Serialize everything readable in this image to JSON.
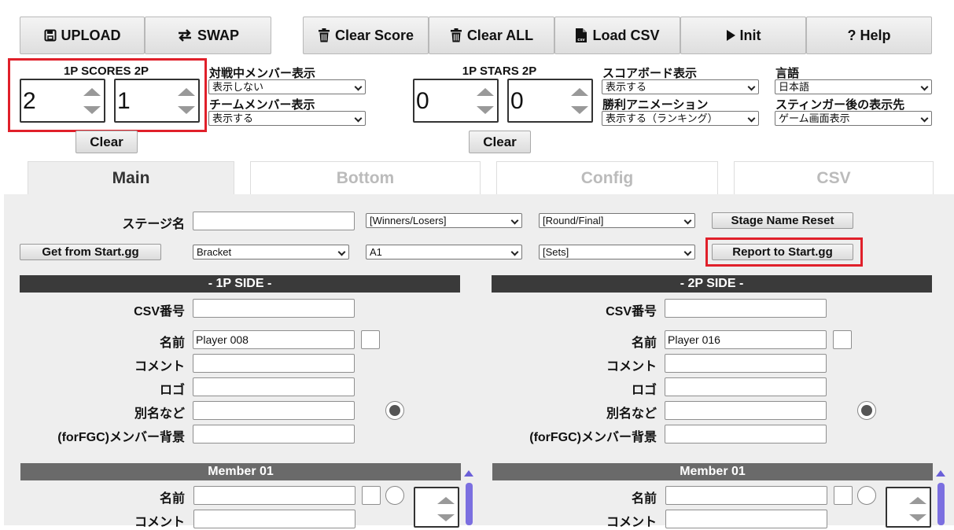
{
  "toolbar": {
    "upload": "UPLOAD",
    "swap": "SWAP",
    "clear_score": "Clear Score",
    "clear_all": "Clear ALL",
    "load_csv": "Load CSV",
    "csv_icon_text": "csv",
    "init": "Init",
    "help": "? Help"
  },
  "scores": {
    "label": "1P SCORES 2P",
    "p1": "2",
    "p2": "1",
    "clear": "Clear"
  },
  "stars": {
    "label": "1P STARS 2P",
    "p1": "0",
    "p2": "0",
    "clear": "Clear"
  },
  "settings": {
    "battle_members_label": "対戦中メンバー表示",
    "battle_members_value": "表示しない",
    "team_members_label": "チームメンバー表示",
    "team_members_value": "表示する",
    "scoreboard_label": "スコアボード表示",
    "scoreboard_value": "表示する",
    "win_anim_label": "勝利アニメーション",
    "win_anim_value": "表示する（ランキング）",
    "language_label": "言語",
    "language_value": "日本語",
    "stinger_label": "スティンガー後の表示先",
    "stinger_value": "ゲーム画面表示"
  },
  "tabs": [
    "Main",
    "Bottom",
    "Config",
    "CSV"
  ],
  "main": {
    "stage_label": "ステージ名",
    "stage_value": "",
    "winners_losers": "[Winners/Losers]",
    "round_final": "[Round/Final]",
    "stage_reset": "Stage Name Reset",
    "get_startgg": "Get from Start.gg",
    "bracket": "Bracket",
    "a1": "A1",
    "sets": "[Sets]",
    "report_startgg": "Report to Start.gg"
  },
  "side1": {
    "header": "- 1P SIDE -",
    "csv_label": "CSV番号",
    "name_label": "名前",
    "name_value": "Player 008",
    "comment_label": "コメント",
    "logo_label": "ロゴ",
    "alias_label": "別名など",
    "bg_label": "(forFGC)メンバー背景",
    "member_header": "Member 01",
    "m_name_label": "名前",
    "m_comment_label": "コメント"
  },
  "side2": {
    "header": "- 2P SIDE -",
    "csv_label": "CSV番号",
    "name_label": "名前",
    "name_value": "Player 016",
    "comment_label": "コメント",
    "logo_label": "ロゴ",
    "alias_label": "別名など",
    "bg_label": "(forFGC)メンバー背景",
    "member_header": "Member 01",
    "m_name_label": "名前",
    "m_comment_label": "コメント"
  },
  "colors": {
    "highlight": "#e0202a",
    "panel_bg": "#eeeeee",
    "side_header": "#3a3a3a",
    "member_header": "#6a6a6a",
    "scroll_accent": "#7b6fe0"
  }
}
